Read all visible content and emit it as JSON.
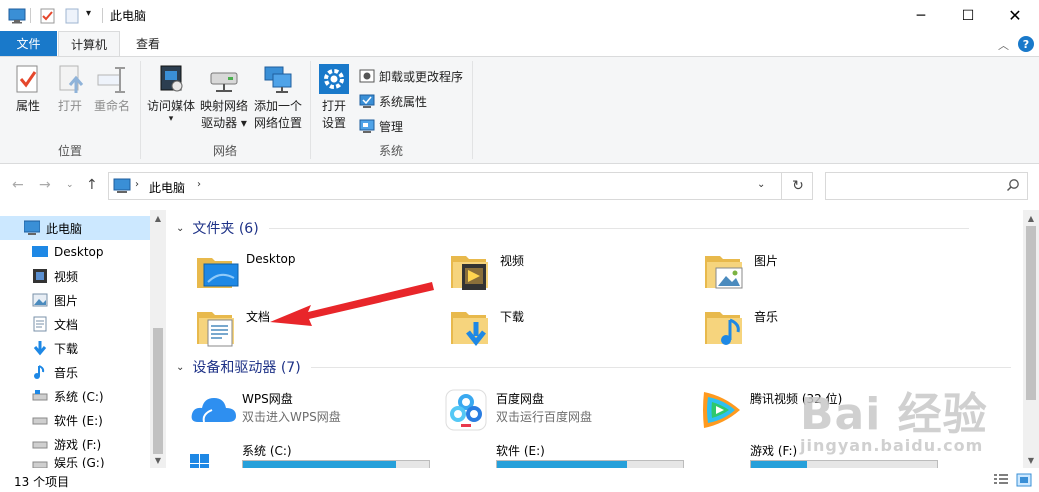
{
  "window": {
    "title": "此电脑"
  },
  "ribbon_tabs": {
    "file": "文件",
    "computer": "计算机",
    "view": "查看"
  },
  "ribbon": {
    "location": {
      "label": "位置",
      "properties": "属性",
      "open": "打开",
      "rename": "重命名"
    },
    "network": {
      "label": "网络",
      "access_media_line1": "访问媒体",
      "map_drive_line1": "映射网络",
      "map_drive_line2": "驱动器 ▾",
      "add_location_line1": "添加一个",
      "add_location_line2": "网络位置"
    },
    "system": {
      "label": "系统",
      "open_settings_line1": "打开",
      "open_settings_line2": "设置",
      "uninstall": "卸载或更改程序",
      "system_properties": "系统属性",
      "manage": "管理"
    }
  },
  "address": {
    "crumb": "此电脑",
    "search_placeholder": ""
  },
  "nav_pane": {
    "items": [
      {
        "label": "此电脑",
        "icon": "computer-icon",
        "selected": true
      },
      {
        "label": "Desktop",
        "icon": "desktop-icon"
      },
      {
        "label": "视频",
        "icon": "video-icon"
      },
      {
        "label": "图片",
        "icon": "pictures-icon"
      },
      {
        "label": "文档",
        "icon": "documents-icon"
      },
      {
        "label": "下载",
        "icon": "downloads-icon"
      },
      {
        "label": "音乐",
        "icon": "music-icon"
      },
      {
        "label": "系统 (C:)",
        "icon": "drive-c-icon"
      },
      {
        "label": "软件 (E:)",
        "icon": "drive-icon"
      },
      {
        "label": "游戏 (F:)",
        "icon": "drive-icon"
      },
      {
        "label": "娱乐 (G:)",
        "icon": "drive-icon"
      }
    ]
  },
  "content": {
    "folders_header": "文件夹 (6)",
    "folders": [
      {
        "name": "Desktop",
        "icon": "desktop-folder-icon"
      },
      {
        "name": "视频",
        "icon": "video-folder-icon"
      },
      {
        "name": "图片",
        "icon": "pictures-folder-icon"
      },
      {
        "name": "文档",
        "icon": "documents-folder-icon"
      },
      {
        "name": "下载",
        "icon": "downloads-folder-icon"
      },
      {
        "name": "音乐",
        "icon": "music-folder-icon"
      }
    ],
    "devices_header": "设备和驱动器 (7)",
    "apps": [
      {
        "name": "WPS网盘",
        "desc": "双击进入WPS网盘",
        "icon": "wps-cloud-icon"
      },
      {
        "name": "百度网盘",
        "desc": "双击运行百度网盘",
        "icon": "baidu-netdisk-icon"
      },
      {
        "name": "腾讯视频 (32 位)",
        "desc": "",
        "icon": "tencent-video-icon"
      }
    ],
    "drives": [
      {
        "name": "系统 (C:)",
        "used_fraction": 0.82,
        "icon": "windows-drive-icon"
      },
      {
        "name": "软件 (E:)",
        "used_fraction": 0.7,
        "icon": "drive-icon"
      },
      {
        "name": "游戏 (F:)",
        "used_fraction": 0.3,
        "icon": "drive-icon"
      }
    ]
  },
  "status": {
    "count": "13 个项目"
  },
  "watermark": {
    "line1": "Bai 经验",
    "line2": "jingyan.baidu.com"
  },
  "colors": {
    "accent": "#1979ca",
    "selection": "#cce8ff",
    "arrow": "#e8262a",
    "drive_fill": "#26a0da"
  }
}
